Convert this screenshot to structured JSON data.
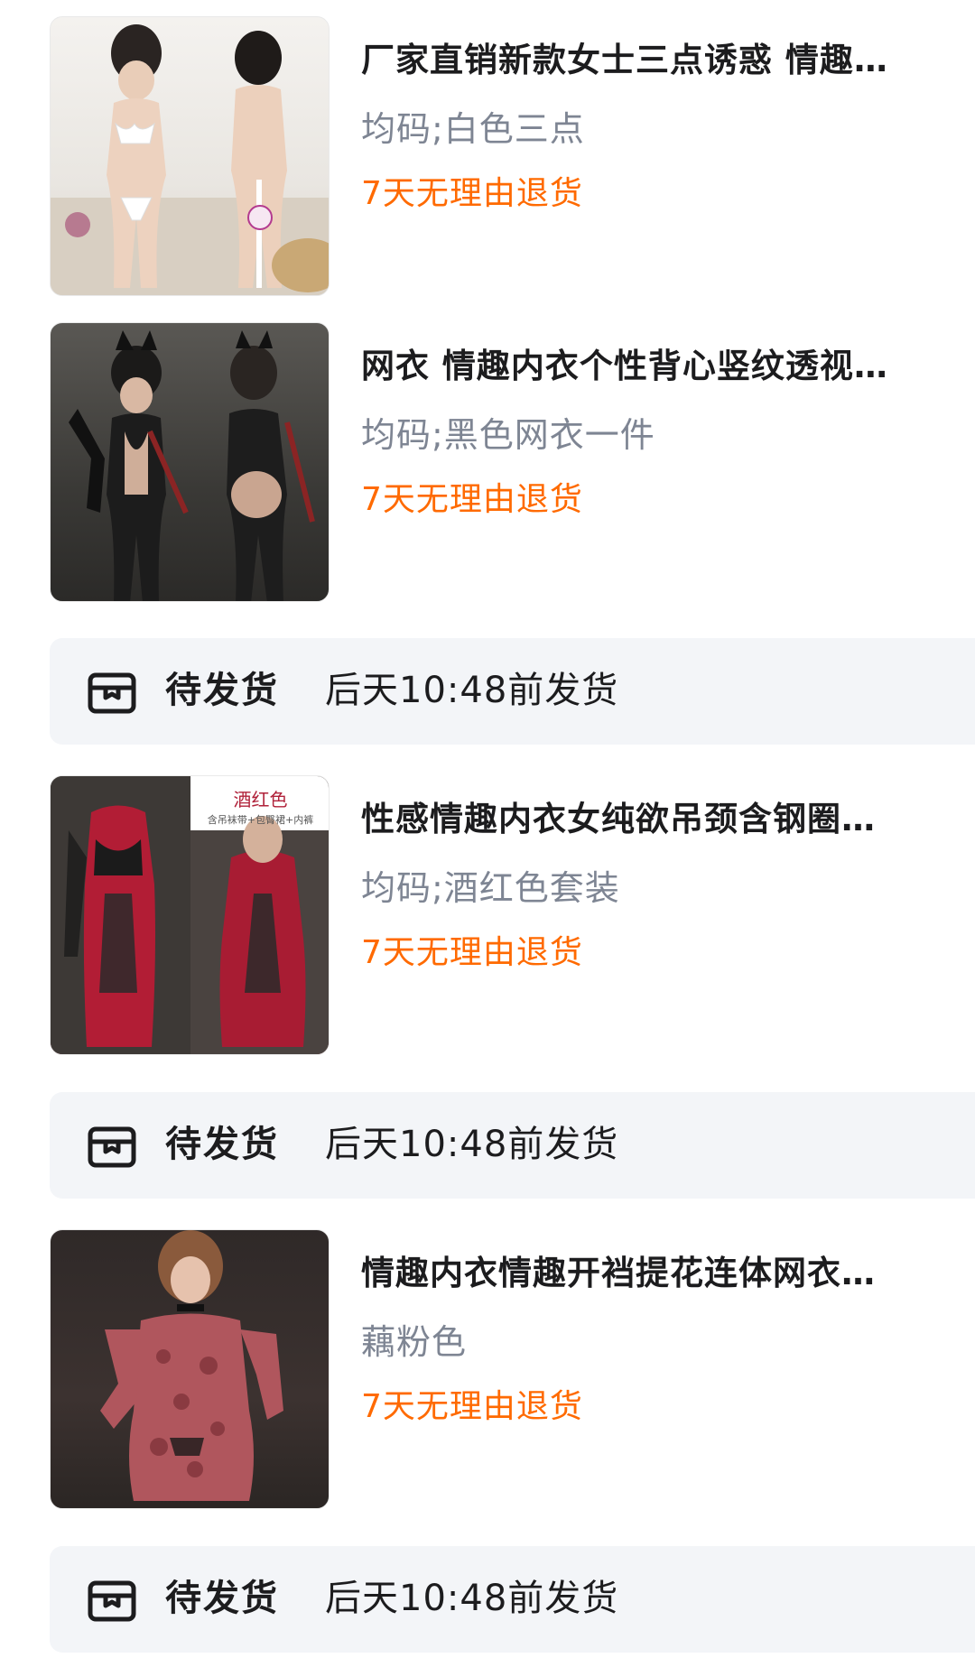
{
  "orders": [
    {
      "title": "厂家直销新款女士三点诱惑 情趣…",
      "spec": "均码;白色三点",
      "returns": "7天无理由退货",
      "image_icon": "product-image"
    },
    {
      "title": "网衣 情趣内衣个性背心竖纹透视…",
      "spec": "均码;黑色网衣一件",
      "returns": "7天无理由退货",
      "image_icon": "product-image"
    },
    {
      "title": "性感情趣内衣女纯欲吊颈含钢圈…",
      "spec": "均码;酒红色套装",
      "returns": "7天无理由退货",
      "image_label": "酒红色",
      "image_sublabel": "含吊袜带+包臀裙+内裤",
      "image_icon": "product-image"
    },
    {
      "title": "情趣内衣情趣开裆提花连体网衣…",
      "spec": "藕粉色",
      "returns": "7天无理由退货",
      "image_icon": "product-image"
    }
  ],
  "shipping": [
    {
      "status": "待发货",
      "time": "后天10:48前发货",
      "icon": "package-icon"
    },
    {
      "status": "待发货",
      "time": "后天10:48前发货",
      "icon": "package-icon"
    },
    {
      "status": "待发货",
      "time": "后天10:48前发货",
      "icon": "package-icon"
    }
  ],
  "colors": {
    "returns": "#ff6a00",
    "spec": "#7e8593",
    "bar_bg": "#f3f5f8"
  }
}
